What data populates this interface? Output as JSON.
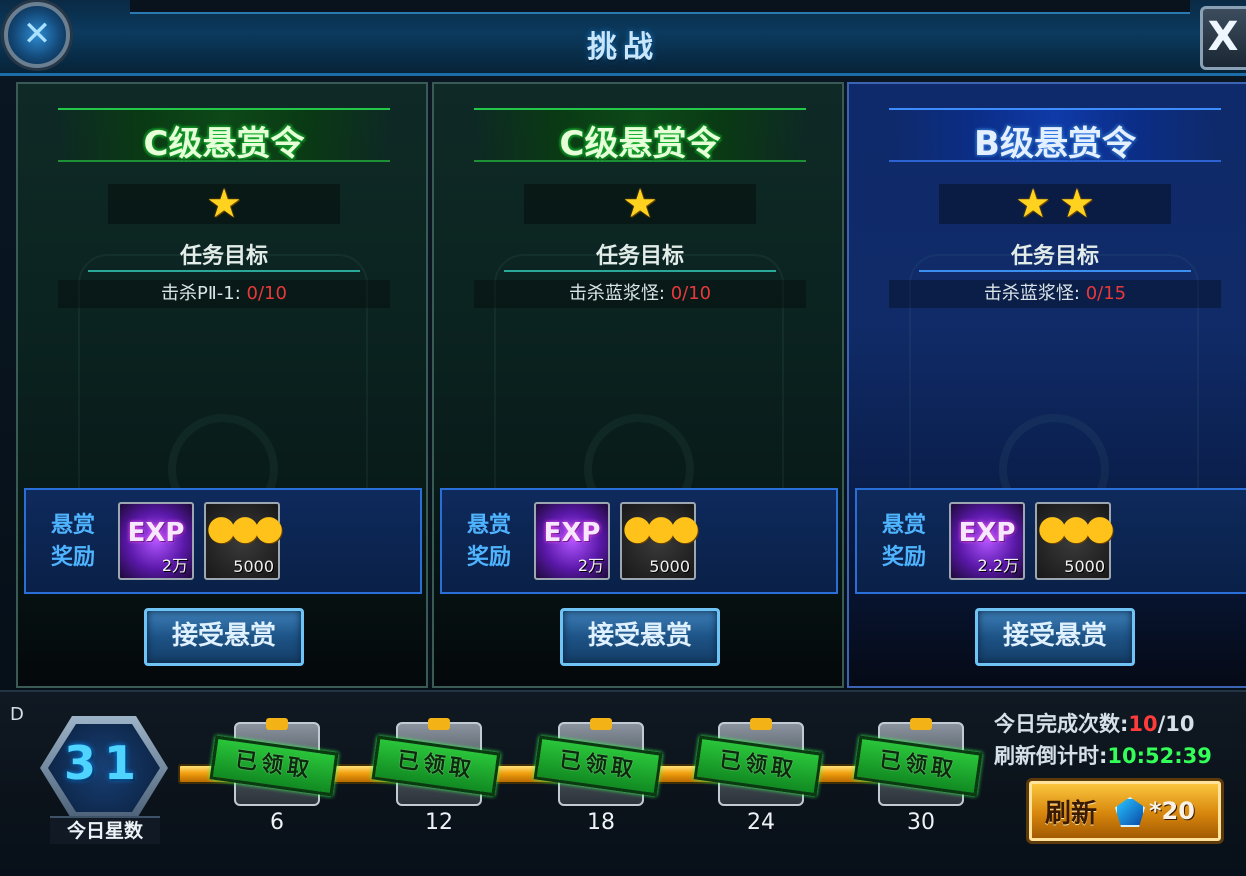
{
  "window": {
    "title": "挑战",
    "close_label": "X",
    "emblem_icon": "crossed-swords-icon"
  },
  "bounties": [
    {
      "grade": "C级悬赏令",
      "stars": 1,
      "objective_label": "任务目标",
      "objective_text": "击杀PⅡ-1:",
      "progress": "0/10",
      "reward_label_1": "悬赏",
      "reward_label_2": "奖励",
      "exp_glyph": "EXP",
      "exp_amount": "2万",
      "gold_amount": "5000",
      "accept_label": "接受悬赏",
      "theme": "green"
    },
    {
      "grade": "C级悬赏令",
      "stars": 1,
      "objective_label": "任务目标",
      "objective_text": "击杀蓝浆怪:",
      "progress": "0/10",
      "reward_label_1": "悬赏",
      "reward_label_2": "奖励",
      "exp_glyph": "EXP",
      "exp_amount": "2万",
      "gold_amount": "5000",
      "accept_label": "接受悬赏",
      "theme": "green"
    },
    {
      "grade": "B级悬赏令",
      "stars": 2,
      "objective_label": "任务目标",
      "objective_text": "击杀蓝浆怪:",
      "progress": "0/15",
      "reward_label_1": "悬赏",
      "reward_label_2": "奖励",
      "exp_glyph": "EXP",
      "exp_amount": "2.2万",
      "gold_amount": "5000",
      "accept_label": "接受悬赏",
      "theme": "blue"
    }
  ],
  "daily": {
    "corner_mark": "D",
    "star_count": "31",
    "star_count_label": "今日星数",
    "milestones": [
      {
        "value": "6",
        "claimed_label": "已领取"
      },
      {
        "value": "12",
        "claimed_label": "已领取"
      },
      {
        "value": "18",
        "claimed_label": "已领取"
      },
      {
        "value": "24",
        "claimed_label": "已领取"
      },
      {
        "value": "30",
        "claimed_label": "已领取"
      }
    ],
    "completed_label": "今日完成次数:",
    "completed_done": "10",
    "completed_total": "/10",
    "countdown_label": "刷新倒计时:",
    "countdown_value": "10:52:39",
    "refresh_label": "刷新",
    "refresh_cost": "*20"
  },
  "colors": {
    "green_accent": "#25c74a",
    "blue_accent": "#3c8dff",
    "progress_red": "#e8393a",
    "timer_green": "#33ff58",
    "gold_button": "#d6850c"
  }
}
